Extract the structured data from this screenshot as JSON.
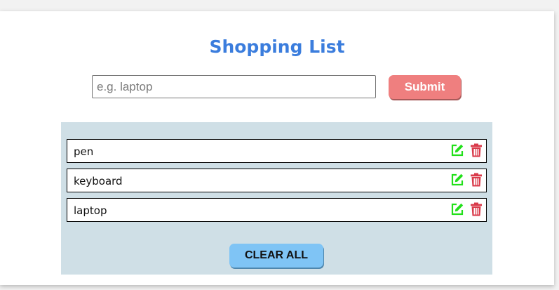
{
  "app": {
    "title": "Shopping List"
  },
  "form": {
    "input_value": "",
    "placeholder": "e.g. laptop",
    "submit_label": "Submit"
  },
  "list": {
    "items": [
      {
        "label": "pen"
      },
      {
        "label": "keyboard"
      },
      {
        "label": "laptop"
      }
    ],
    "clear_label": "CLEAR ALL"
  },
  "icons": {
    "edit": "edit-icon",
    "delete": "trash-icon"
  },
  "colors": {
    "title": "#3b7ddd",
    "submit_bg": "#ef7f7f",
    "clear_bg": "#7fc4f5",
    "panel_bg": "#cfdfe6",
    "edit_icon": "#22e01a",
    "delete_icon": "#d93a4a"
  }
}
